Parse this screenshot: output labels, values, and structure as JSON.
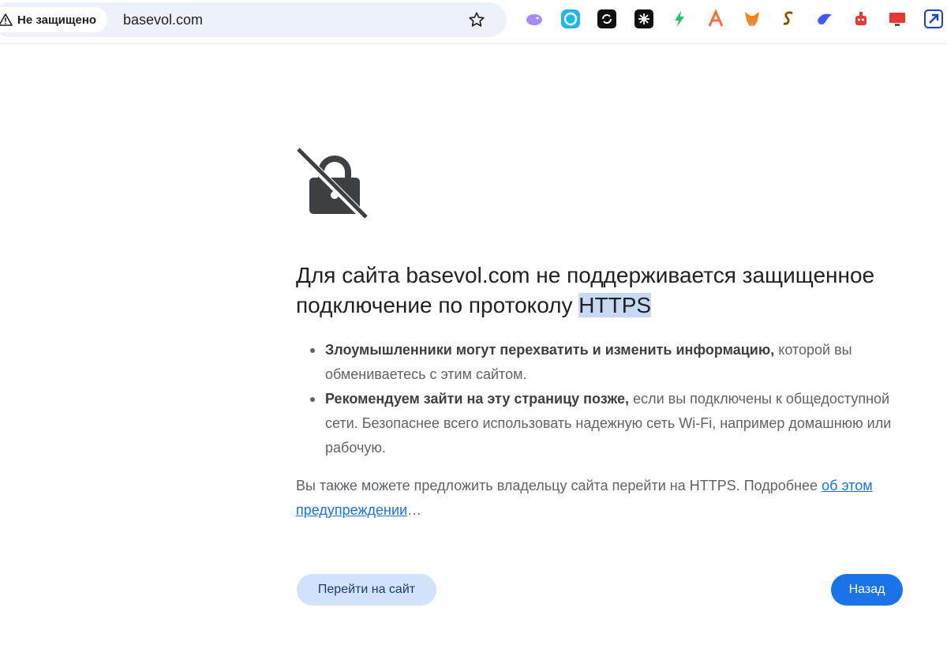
{
  "browser": {
    "security_chip": "Не защищено",
    "url": "basevol.com",
    "bookmark_icon": "star-icon",
    "extensions": [
      {
        "icon": "purple-whale-icon",
        "color": "#a78bfa"
      },
      {
        "icon": "cyan-circle-icon",
        "color": "#1fb6e8"
      },
      {
        "icon": "black-refresh-icon",
        "color": "#111111"
      },
      {
        "icon": "black-snowflake-icon",
        "color": "#111111"
      },
      {
        "icon": "green-bolt-icon",
        "color": "#2bbd74"
      },
      {
        "icon": "orange-a-icon",
        "color": "#ff6b3d"
      },
      {
        "icon": "metamask-fox-icon",
        "color": "#f6851b"
      },
      {
        "icon": "striped-s-icon",
        "color": "#e59c00"
      },
      {
        "icon": "blue-bird-icon",
        "color": "#3d5afe"
      },
      {
        "icon": "red-robot-icon",
        "color": "#e53935"
      },
      {
        "icon": "red-monitor-icon",
        "color": "#e53935"
      },
      {
        "icon": "blue-arrow-icon",
        "color": "#1a3fd8"
      }
    ]
  },
  "interstitial": {
    "icon": "crossed-lock-icon",
    "heading_main": "Для сайта basevol.com не поддерживается защищенное подключение по протоколу ",
    "heading_highlight": "HTTPS",
    "bullets": [
      {
        "bold": "Злоумышленники могут перехватить и изменить информацию,",
        "text": " которой вы обмениваетесь с этим сайтом."
      },
      {
        "bold": "Рекомендуем зайти на эту страницу позже,",
        "text": " если вы подключены к общедоступной сети. Безопаснее всего использовать надежную сеть Wi-Fi, например домашнюю или рабочую."
      }
    ],
    "extra_text": "Вы также можете предложить владельцу сайта перейти на HTTPS. Подробнее ",
    "extra_link": "об этом предупреждении",
    "extra_tail": "…",
    "proceed_button": "Перейти на сайт",
    "back_button": "Назад"
  },
  "colors": {
    "accent": "#1a73e8",
    "proceed_bg": "#d3e3fd",
    "highlight": "#c8d9f4",
    "icon_gray": "#3c4043"
  }
}
